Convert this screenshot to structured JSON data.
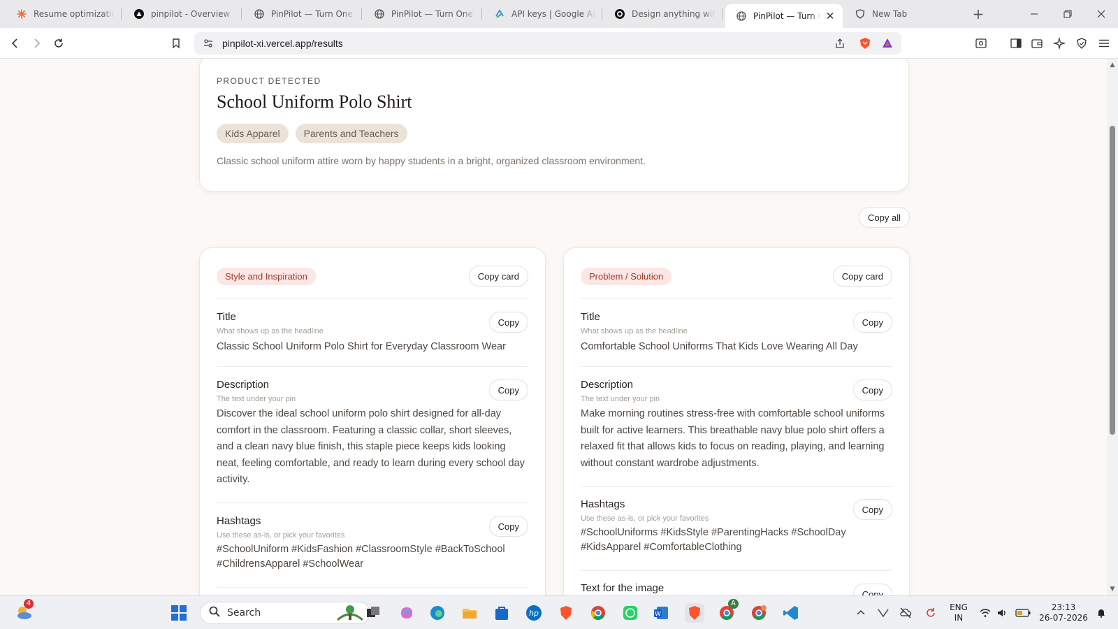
{
  "browser": {
    "tabs": [
      {
        "title": "Resume optimization",
        "icon": "sparkle-icon"
      },
      {
        "title": "pinpilot - Overview – V",
        "icon": "vercel-icon"
      },
      {
        "title": "PinPilot — Turn One P",
        "icon": "globe-icon"
      },
      {
        "title": "PinPilot — Turn One P",
        "icon": "globe-icon"
      },
      {
        "title": "API keys | Google AI S",
        "icon": "google-ai-studio-icon"
      },
      {
        "title": "Design anything with",
        "icon": "design-tool-icon"
      },
      {
        "title": "PinPilot — Turn O",
        "icon": "globe-icon",
        "active": true
      },
      {
        "title": "New Tab",
        "icon": "brave-shield-icon"
      }
    ],
    "url": "pinpilot-xi.vercel.app/results"
  },
  "page": {
    "product": {
      "eyebrow": "PRODUCT DETECTED",
      "title": "School Uniform Polo Shirt",
      "tags": [
        "Kids Apparel",
        "Parents and Teachers"
      ],
      "summary": "Classic school uniform attire worn by happy students in a bright, organized classroom environment."
    },
    "copy_all_label": "Copy all",
    "cards": [
      {
        "style": "Style and Inspiration",
        "copy_card_label": "Copy card",
        "fields": [
          {
            "label": "Title",
            "hint": "What shows up as the headline",
            "copy": "Copy",
            "value": "Classic School Uniform Polo Shirt for Everyday Classroom Wear"
          },
          {
            "label": "Description",
            "hint": "The text under your pin",
            "copy": "Copy",
            "value": "Discover the ideal school uniform polo shirt designed for all-day comfort in the classroom. Featuring a classic collar, short sleeves, and a clean navy blue finish, this staple piece keeps kids looking neat, feeling comfortable, and ready to learn during every school day activity."
          },
          {
            "label": "Hashtags",
            "hint": "Use these as-is, or pick your favorites",
            "copy": "Copy",
            "value": "#SchoolUniform #KidsFashion #ClassroomStyle #BackToSchool #ChildrensApparel #SchoolWear"
          }
        ]
      },
      {
        "style": "Problem / Solution",
        "copy_card_label": "Copy card",
        "fields": [
          {
            "label": "Title",
            "hint": "What shows up as the headline",
            "copy": "Copy",
            "value": "Comfortable School Uniforms That Kids Love Wearing All Day"
          },
          {
            "label": "Description",
            "hint": "The text under your pin",
            "copy": "Copy",
            "value": "Make morning routines stress-free with comfortable school uniforms built for active learners. This breathable navy blue polo shirt offers a relaxed fit that allows kids to focus on reading, playing, and learning without constant wardrobe adjustments."
          },
          {
            "label": "Hashtags",
            "hint": "Use these as-is, or pick your favorites",
            "copy": "Copy",
            "value": "#SchoolUniforms #KidsStyle #ParentingHacks #SchoolDay #KidsApparel #ComfortableClothing"
          },
          {
            "label": "Text for the image",
            "copy": "Copy"
          }
        ]
      }
    ]
  },
  "taskbar": {
    "weather_badge": "4",
    "search_placeholder": "Search",
    "chrome_profile_badge": "A",
    "language": "ENG",
    "region": "IN",
    "time": "23:13",
    "date": "26-07-2026"
  },
  "colors": {
    "page_bg": "#fbf8f6",
    "pill_bg": "#fbe7e4",
    "pill_text": "#a33a2a",
    "chip_bg": "#ece3d8"
  }
}
